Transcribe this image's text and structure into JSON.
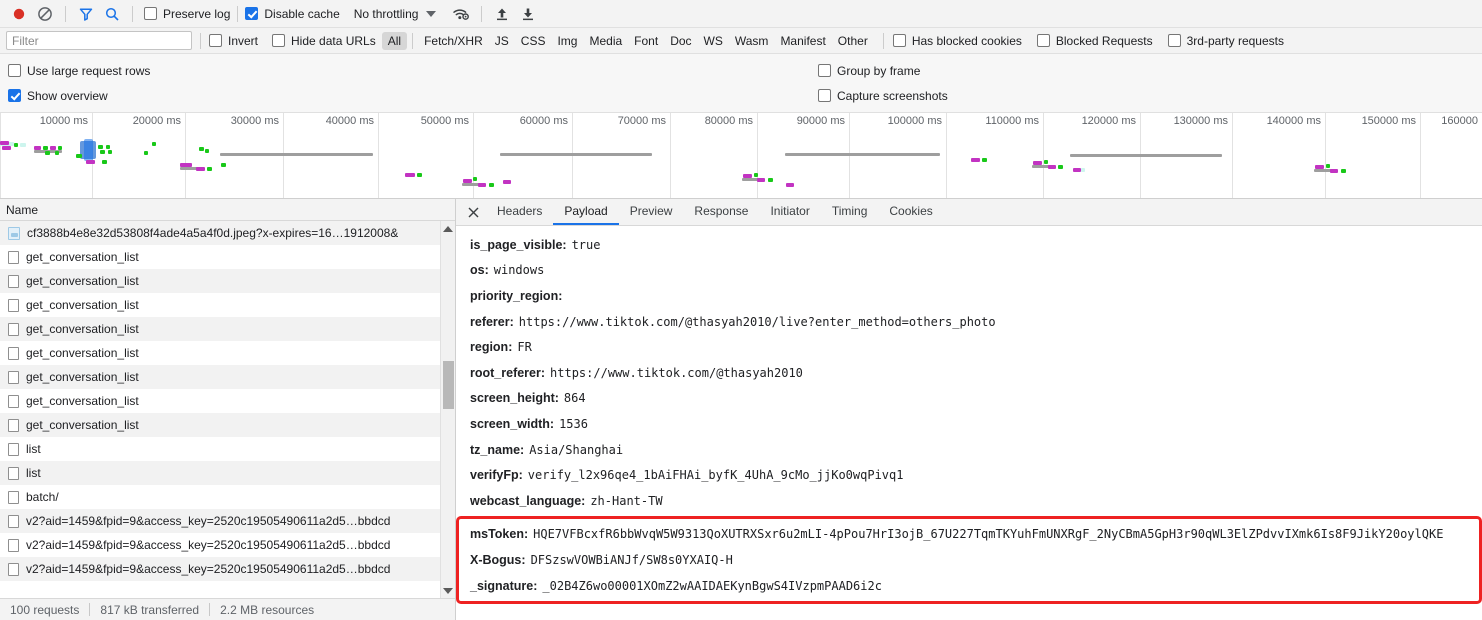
{
  "toolbar": {
    "record_icon": "record-circle-icon",
    "clear_icon": "clear-prohibited-icon",
    "filter_icon": "funnel-icon",
    "search_icon": "search-magnifier-icon",
    "preserve_log": {
      "label": "Preserve log",
      "checked": false
    },
    "disable_cache": {
      "label": "Disable cache",
      "checked": true
    },
    "throttling": {
      "label": "No throttling",
      "caret_icon": "chevron-down-icon"
    },
    "network_conditions_icon": "wifi-gear-icon",
    "import_icon": "upload-arrow-icon",
    "export_icon": "download-arrow-icon"
  },
  "filterbar": {
    "filter_placeholder": "Filter",
    "filter_value": "",
    "invert": {
      "label": "Invert",
      "checked": false
    },
    "hide_data_urls": {
      "label": "Hide data URLs",
      "checked": false
    },
    "types": [
      "All",
      "Fetch/XHR",
      "JS",
      "CSS",
      "Img",
      "Media",
      "Font",
      "Doc",
      "WS",
      "Wasm",
      "Manifest",
      "Other"
    ],
    "active_type": "All",
    "has_blocked_cookies": {
      "label": "Has blocked cookies",
      "checked": false
    },
    "blocked_requests": {
      "label": "Blocked Requests",
      "checked": false
    },
    "third_party_requests": {
      "label": "3rd-party requests",
      "checked": false
    }
  },
  "settings": {
    "use_large_request_rows": {
      "label": "Use large request rows",
      "checked": false
    },
    "show_overview": {
      "label": "Show overview",
      "checked": true
    },
    "group_by_frame": {
      "label": "Group by frame",
      "checked": false
    },
    "capture_screenshots": {
      "label": "Capture screenshots",
      "checked": false
    }
  },
  "overview": {
    "ticks": [
      "10000 ms",
      "20000 ms",
      "30000 ms",
      "40000 ms",
      "50000 ms",
      "60000 ms",
      "70000 ms",
      "80000 ms",
      "90000 ms",
      "100000 ms",
      "110000 ms",
      "120000 ms",
      "130000 ms",
      "140000 ms",
      "150000 ms",
      "160000"
    ]
  },
  "requests": {
    "column_header": "Name",
    "rows": [
      {
        "icon": "image-file-icon",
        "name": "cf3888b4e8e32d53808f4ade4a5a4f0d.jpeg?x-expires=16…1912008&"
      },
      {
        "icon": "document-file-icon",
        "name": "get_conversation_list"
      },
      {
        "icon": "document-file-icon",
        "name": "get_conversation_list"
      },
      {
        "icon": "document-file-icon",
        "name": "get_conversation_list"
      },
      {
        "icon": "document-file-icon",
        "name": "get_conversation_list"
      },
      {
        "icon": "document-file-icon",
        "name": "get_conversation_list"
      },
      {
        "icon": "document-file-icon",
        "name": "get_conversation_list"
      },
      {
        "icon": "document-file-icon",
        "name": "get_conversation_list"
      },
      {
        "icon": "document-file-icon",
        "name": "get_conversation_list"
      },
      {
        "icon": "document-file-icon",
        "name": "list"
      },
      {
        "icon": "document-file-icon",
        "name": "list"
      },
      {
        "icon": "document-file-icon",
        "name": "batch/"
      },
      {
        "icon": "document-file-icon",
        "name": "v2?aid=1459&fpid=9&access_key=2520c19505490611a2d5…bbdcd"
      },
      {
        "icon": "document-file-icon",
        "name": "v2?aid=1459&fpid=9&access_key=2520c19505490611a2d5…bbdcd"
      },
      {
        "icon": "document-file-icon",
        "name": "v2?aid=1459&fpid=9&access_key=2520c19505490611a2d5…bbdcd"
      }
    ]
  },
  "statusbar": {
    "requests": "100 requests",
    "transferred": "817 kB transferred",
    "resources": "2.2 MB resources"
  },
  "detail": {
    "close_icon": "close-x-icon",
    "tabs": [
      "Headers",
      "Payload",
      "Preview",
      "Response",
      "Initiator",
      "Timing",
      "Cookies"
    ],
    "active_tab": "Payload"
  },
  "payload": {
    "fields": [
      {
        "key": "is_page_visible:",
        "value": "true"
      },
      {
        "key": "os:",
        "value": "windows"
      },
      {
        "key": "priority_region:",
        "value": ""
      },
      {
        "key": "referer:",
        "value": "https://www.tiktok.com/@thasyah2010/live?enter_method=others_photo"
      },
      {
        "key": "region:",
        "value": "FR"
      },
      {
        "key": "root_referer:",
        "value": "https://www.tiktok.com/@thasyah2010"
      },
      {
        "key": "screen_height:",
        "value": "864"
      },
      {
        "key": "screen_width:",
        "value": "1536"
      },
      {
        "key": "tz_name:",
        "value": "Asia/Shanghai"
      },
      {
        "key": "verifyFp:",
        "value": "verify_l2x96qe4_1bAiFHAi_byfK_4UhA_9cMo_jjKo0wqPivq1"
      },
      {
        "key": "webcast_language:",
        "value": "zh-Hant-TW"
      }
    ],
    "highlighted_fields": [
      {
        "key": "msToken:",
        "value": "HQE7VFBcxfR6bbWvqW5W9313QoXUTRXSxr6u2mLI-4pPou7HrI3ojB_67U227TqmTKYuhFmUNXRgF_2NyCBmA5GpH3r90qWL3ElZPdvvIXmk6Is8F9JikY20oylQKE"
      },
      {
        "key": "X-Bogus:",
        "value": "DFSzswVOWBiANJf/SW8s0YXAIQ-H"
      },
      {
        "key": "_signature:",
        "value": "_02B4Z6wo00001XOmZ2wAAIDAEKynBgwS4IVzpmPAAD6i2c"
      }
    ],
    "highlight_color": "#ee2222"
  }
}
